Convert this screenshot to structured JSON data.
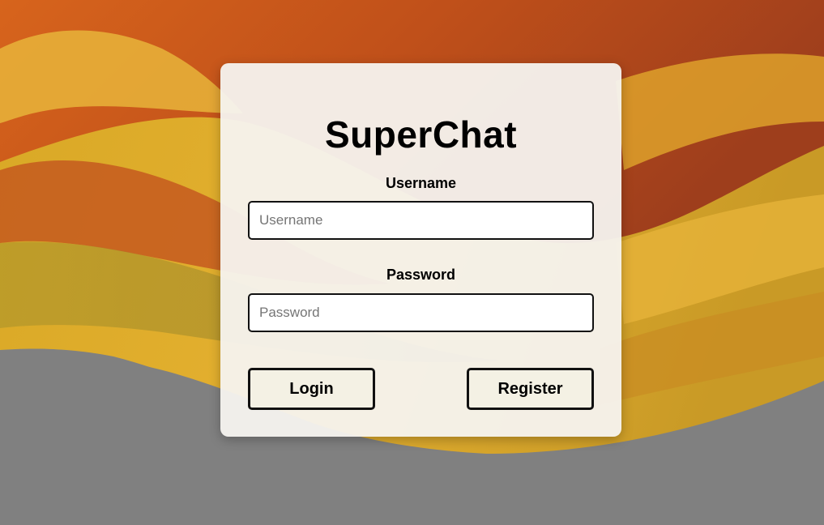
{
  "app": {
    "title": "SuperChat"
  },
  "form": {
    "username_label": "Username",
    "username_placeholder": "Username",
    "username_value": "",
    "password_label": "Password",
    "password_placeholder": "Password",
    "password_value": "",
    "login_label": "Login",
    "register_label": "Register"
  },
  "colors": {
    "background_gray": "#808080",
    "wallpaper_orange": "#c8561a",
    "wallpaper_yellow": "#e0a020",
    "card_background": "#f6f3ef",
    "button_background": "#f4f1e4",
    "border": "#111111"
  }
}
